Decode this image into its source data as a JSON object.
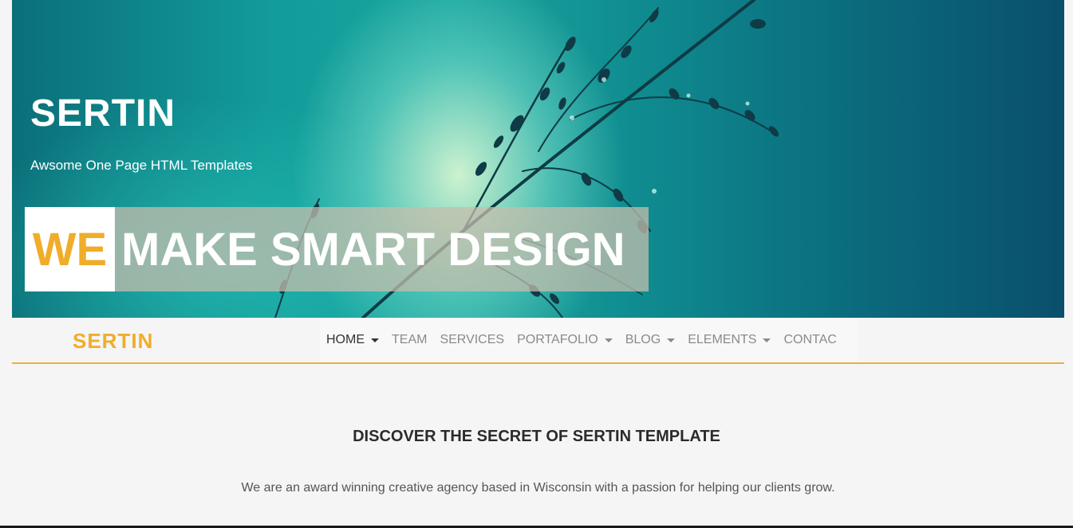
{
  "hero": {
    "title": "SERTIN",
    "subtitle": "Awsome One Page HTML Templates",
    "banner_highlight": "WE",
    "banner_text": "MAKE SMART DESIGN"
  },
  "navbar": {
    "brand": "SERTIN",
    "items": [
      {
        "label": "HOME",
        "dropdown": true,
        "active": true
      },
      {
        "label": "TEAM",
        "dropdown": false,
        "active": false
      },
      {
        "label": "SERVICES",
        "dropdown": false,
        "active": false
      },
      {
        "label": "PORTAFOLIO",
        "dropdown": true,
        "active": false
      },
      {
        "label": "BLOG",
        "dropdown": true,
        "active": false
      },
      {
        "label": "ELEMENTS",
        "dropdown": true,
        "active": false
      },
      {
        "label": "CONTAC",
        "dropdown": false,
        "active": false
      }
    ]
  },
  "section": {
    "title": "DISCOVER THE SECRET OF SERTIN TEMPLATE",
    "text": "We are an award winning creative agency based in Wisconsin with a passion for helping our clients grow."
  },
  "colors": {
    "accent": "#f0ad2a",
    "hero_teal": "#129c9a",
    "navbar_rule": "#e8b04a"
  }
}
